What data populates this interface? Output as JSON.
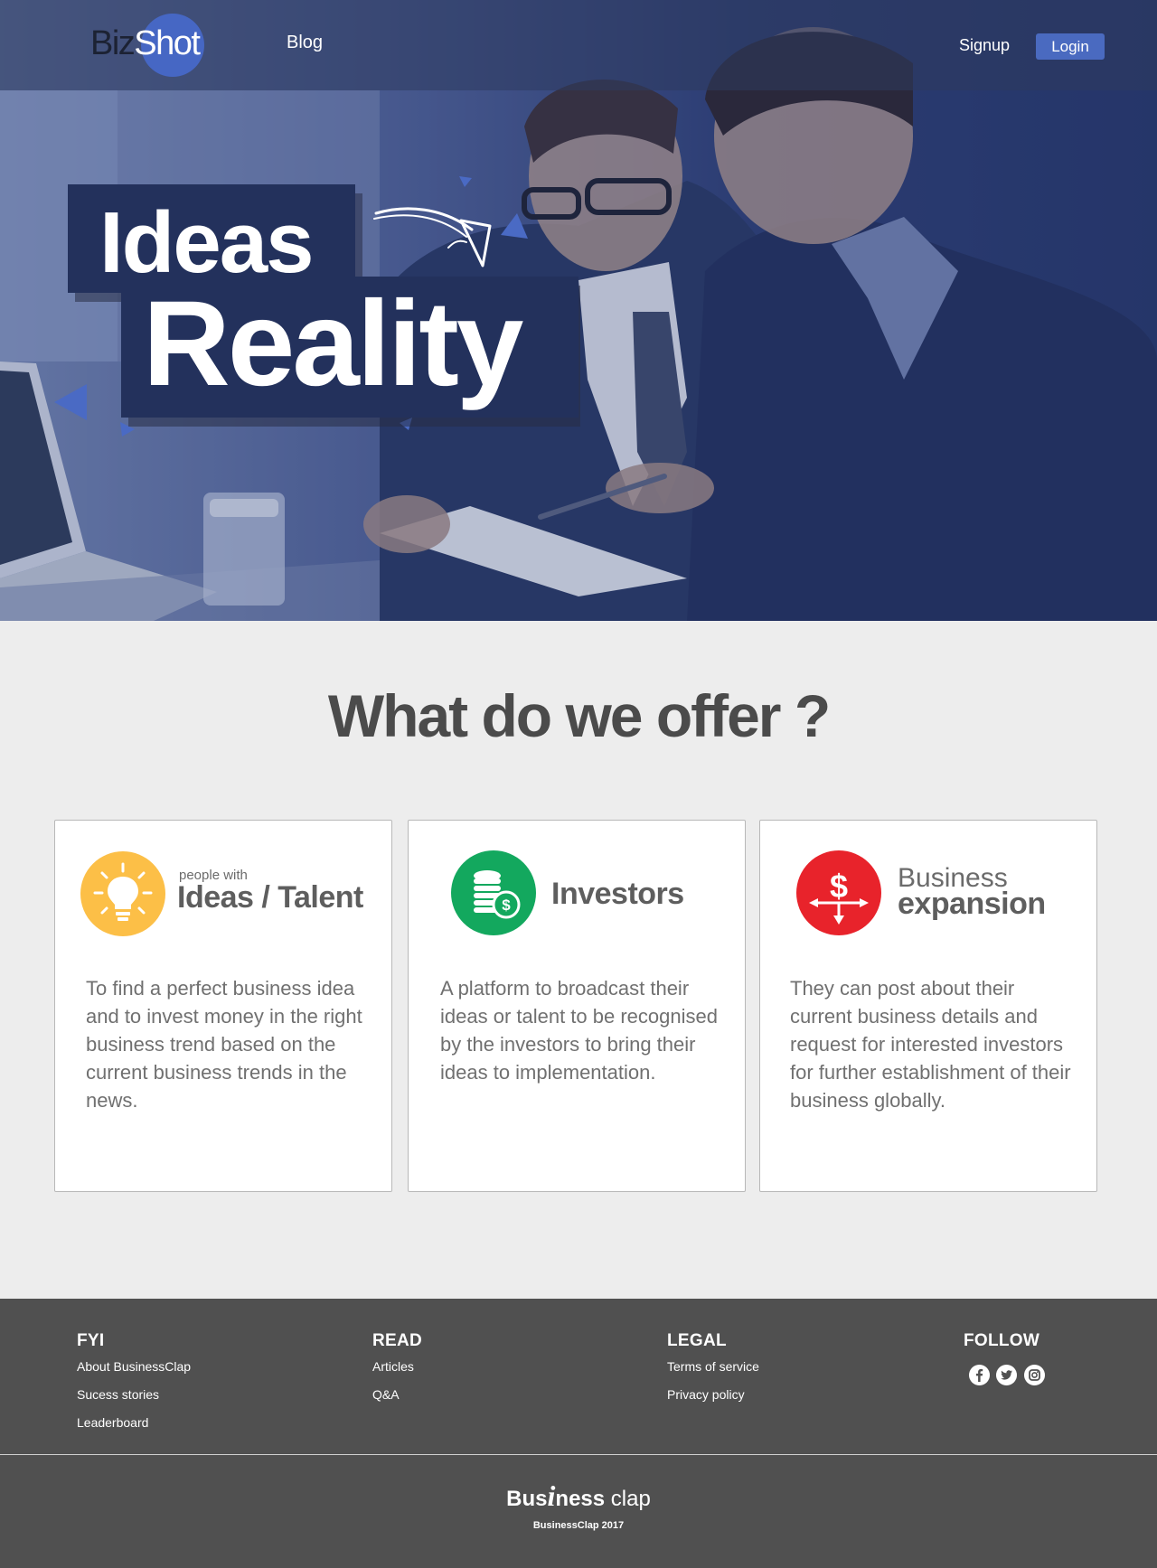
{
  "header": {
    "logo_part1": "Biz",
    "logo_part2": "Shot",
    "nav_blog": "Blog",
    "signup": "Signup",
    "login": "Login"
  },
  "hero": {
    "line1": "Ideas",
    "line2": "Reality"
  },
  "offer": {
    "title": "What do we offer ?",
    "cards": [
      {
        "subheading": "people with",
        "heading": "Ideas / Talent",
        "icon": "lightbulb-icon",
        "color": "#fcbf47",
        "description": "To find a perfect business idea and to invest money in the right business trend based on the current business trends in the news."
      },
      {
        "heading": "Investors",
        "icon": "coins-icon",
        "color": "#13a85e",
        "description": "A platform to broadcast their ideas or talent to be recognised by the investors to bring their ideas to implementation."
      },
      {
        "heading_top": "Business",
        "heading": "expansion",
        "icon": "dollar-expansion-icon",
        "color": "#e8232b",
        "description": "They can post about their current business details and request for interested investors for further establishment of their business globally."
      }
    ]
  },
  "footer": {
    "fyi": {
      "title": "FYI",
      "links": [
        "About BusinessClap",
        "Sucess stories",
        "Leaderboard"
      ]
    },
    "read": {
      "title": "READ",
      "links": [
        "Articles",
        "Q&A"
      ]
    },
    "legal": {
      "title": "LEGAL",
      "links": [
        "Terms of service",
        "Privacy policy"
      ]
    },
    "follow": {
      "title": "FOLLOW",
      "icons": [
        "facebook-icon",
        "twitter-icon",
        "instagram-icon"
      ]
    },
    "brand_bus": "Bus",
    "brand_i": "i",
    "brand_ness": "ness",
    "brand_clap": "clap",
    "copyright": "BusinessClap 2017"
  }
}
